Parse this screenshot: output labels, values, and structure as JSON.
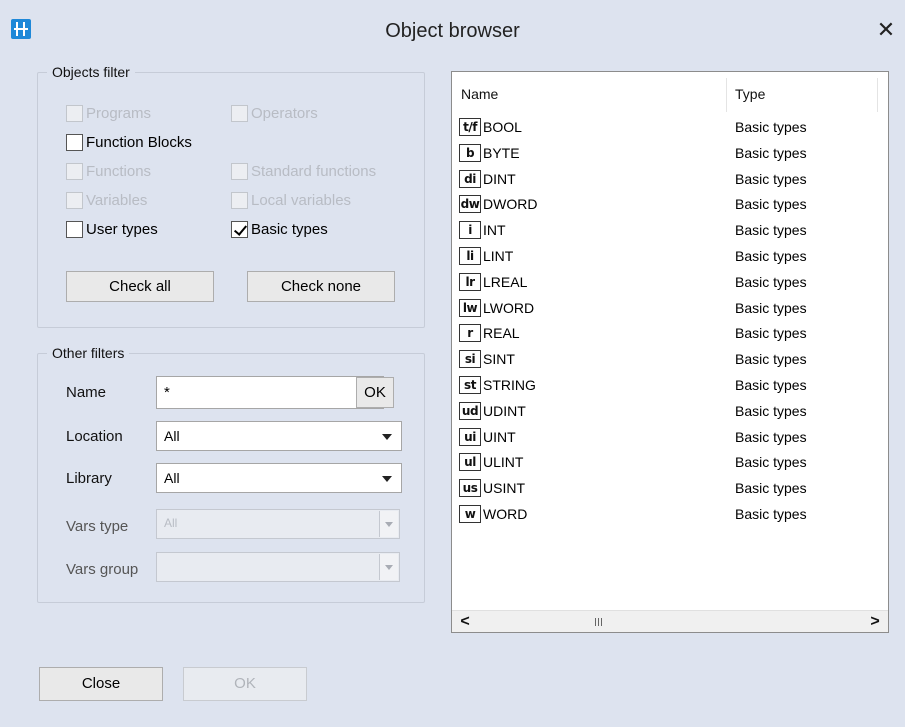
{
  "window": {
    "title": "Object browser",
    "app_icon": "app-icon",
    "close_glyph": "✕"
  },
  "objects_filter": {
    "legend": "Objects filter",
    "checkboxes": [
      {
        "label": "Programs",
        "checked": false,
        "enabled": false
      },
      {
        "label": "Operators",
        "checked": false,
        "enabled": false
      },
      {
        "label": "Function Blocks",
        "checked": false,
        "enabled": true
      },
      {
        "label": "Functions",
        "checked": false,
        "enabled": false
      },
      {
        "label": "Standard functions",
        "checked": false,
        "enabled": false
      },
      {
        "label": "Variables",
        "checked": false,
        "enabled": false
      },
      {
        "label": "Local variables",
        "checked": false,
        "enabled": false
      },
      {
        "label": "User types",
        "checked": false,
        "enabled": true
      },
      {
        "label": "Basic types",
        "checked": true,
        "enabled": true
      }
    ],
    "check_all": "Check all",
    "check_none": "Check none"
  },
  "other_filters": {
    "legend": "Other filters",
    "name_label": "Name",
    "name_value": "*",
    "ok_label": "OK",
    "location_label": "Location",
    "location_value": "All",
    "library_label": "Library",
    "library_value": "All",
    "vars_type_label": "Vars type",
    "vars_type_value": "All",
    "vars_group_label": "Vars group",
    "vars_group_value": ""
  },
  "list": {
    "columns": [
      "Name",
      "Type"
    ],
    "rows": [
      {
        "icon": "t/f",
        "name": "BOOL",
        "type": "Basic types"
      },
      {
        "icon": "b",
        "name": "BYTE",
        "type": "Basic types"
      },
      {
        "icon": "di",
        "name": "DINT",
        "type": "Basic types"
      },
      {
        "icon": "dw",
        "name": "DWORD",
        "type": "Basic types"
      },
      {
        "icon": "i",
        "name": "INT",
        "type": "Basic types"
      },
      {
        "icon": "li",
        "name": "LINT",
        "type": "Basic types"
      },
      {
        "icon": "lr",
        "name": "LREAL",
        "type": "Basic types"
      },
      {
        "icon": "lw",
        "name": "LWORD",
        "type": "Basic types"
      },
      {
        "icon": "r",
        "name": "REAL",
        "type": "Basic types"
      },
      {
        "icon": "si",
        "name": "SINT",
        "type": "Basic types"
      },
      {
        "icon": "st",
        "name": "STRING",
        "type": "Basic types"
      },
      {
        "icon": "ud",
        "name": "UDINT",
        "type": "Basic types"
      },
      {
        "icon": "ui",
        "name": "UINT",
        "type": "Basic types"
      },
      {
        "icon": "ul",
        "name": "ULINT",
        "type": "Basic types"
      },
      {
        "icon": "us",
        "name": "USINT",
        "type": "Basic types"
      },
      {
        "icon": "w",
        "name": "WORD",
        "type": "Basic types"
      }
    ],
    "scroll_left": "<",
    "scroll_right": ">"
  },
  "footer": {
    "close_label": "Close",
    "ok_label": "OK"
  }
}
